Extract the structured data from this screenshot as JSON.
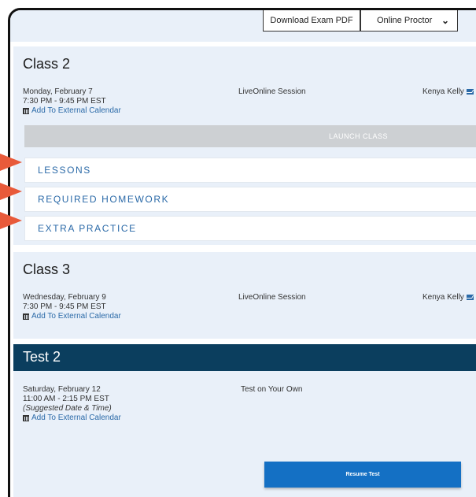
{
  "toolbar": {
    "download_pdf_label": "Download Exam PDF",
    "proctor_select_value": "Online Proctor"
  },
  "class2": {
    "title": "Class 2",
    "date": "Monday, February 7",
    "time": "7:30 PM - 9:45 PM EST",
    "calendar_link": "Add To External Calendar",
    "session_type": "LiveOnline Session",
    "instructor": "Kenya Kelly",
    "launch_label": "LAUNCH CLASS",
    "tabs": [
      {
        "label": "LESSONS"
      },
      {
        "label": "REQUIRED HOMEWORK"
      },
      {
        "label": "EXTRA PRACTICE"
      }
    ]
  },
  "class3": {
    "title": "Class 3",
    "date": "Wednesday, February 9",
    "time": "7:30 PM - 9:45 PM EST",
    "calendar_link": "Add To External Calendar",
    "session_type": "LiveOnline Session",
    "instructor": "Kenya Kelly"
  },
  "test2": {
    "title": "Test 2",
    "date": "Saturday, February 12",
    "time": "11:00 AM - 2:15 PM EST",
    "note": "(Suggested Date & Time)",
    "calendar_link": "Add To External Calendar",
    "session_type": "Test on Your Own",
    "resume_label": "Resume Test"
  },
  "colors": {
    "card_bg": "#e9f0f9",
    "link_blue": "#2b6aa8",
    "test_header": "#0b3e5e",
    "primary_button": "#1470c4",
    "annotation_arrow": "#e85a3a"
  }
}
